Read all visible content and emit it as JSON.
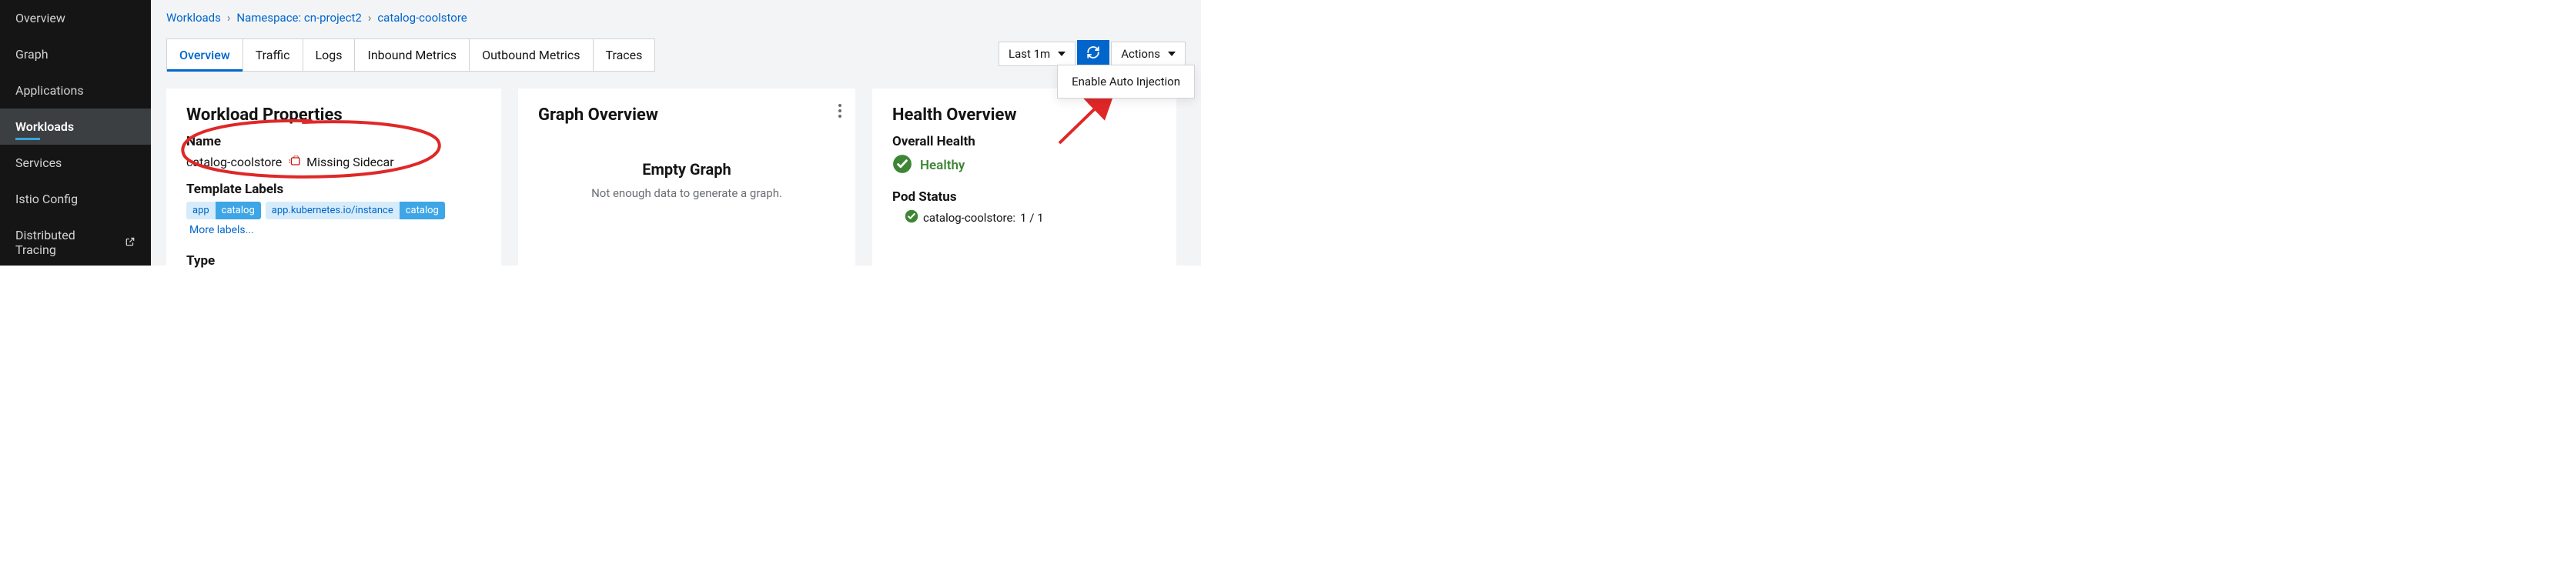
{
  "sidebar": {
    "items": [
      {
        "label": "Overview"
      },
      {
        "label": "Graph"
      },
      {
        "label": "Applications"
      },
      {
        "label": "Workloads"
      },
      {
        "label": "Services"
      },
      {
        "label": "Istio Config"
      },
      {
        "label": "Distributed Tracing"
      }
    ]
  },
  "breadcrumb": {
    "root": "Workloads",
    "ns_prefix": "Namespace:",
    "ns_value": "cn-project2",
    "current": "catalog-coolstore"
  },
  "tabs": [
    {
      "label": "Overview"
    },
    {
      "label": "Traffic"
    },
    {
      "label": "Logs"
    },
    {
      "label": "Inbound Metrics"
    },
    {
      "label": "Outbound Metrics"
    },
    {
      "label": "Traces"
    }
  ],
  "toolbar": {
    "time_range": "Last 1m",
    "actions_label": "Actions"
  },
  "actions_menu": {
    "item_0": "Enable Auto Injection"
  },
  "wp": {
    "title": "Workload Properties",
    "name_heading": "Name",
    "name_value": "catalog-coolstore",
    "missing_sidecar": "Missing Sidecar",
    "labels_heading": "Template Labels",
    "labels": [
      {
        "key": "app",
        "val": "catalog"
      },
      {
        "key": "app.kubernetes.io/instance",
        "val": "catalog"
      }
    ],
    "more_labels": "More labels...",
    "type_heading": "Type"
  },
  "go": {
    "title": "Graph Overview",
    "empty_title": "Empty Graph",
    "empty_sub": "Not enough data to generate a graph."
  },
  "ho": {
    "title": "Health Overview",
    "overall_heading": "Overall Health",
    "status_text": "Healthy",
    "pod_heading": "Pod Status",
    "pod_name": "catalog-coolstore:",
    "pod_count": "1 / 1"
  },
  "colors": {
    "accent": "#0066cc",
    "green": "#3e8635",
    "red": "#e02727"
  }
}
